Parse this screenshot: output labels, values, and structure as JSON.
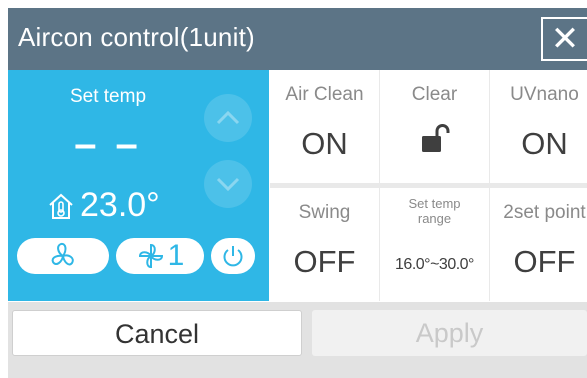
{
  "window": {
    "title": "Aircon control(1unit)",
    "close_label": "✕"
  },
  "left_panel": {
    "set_temp_label": "Set temp",
    "set_temp_value": "– –",
    "room_temp": "23.0°",
    "fan_speed_value": "1",
    "colors": {
      "accent": "#2fb7e6"
    }
  },
  "grid": [
    {
      "label": "Air Clean",
      "value": "ON"
    },
    {
      "label": "Clear",
      "icon": "unlocked-padlock-icon"
    },
    {
      "label": "UVnano",
      "value": "ON"
    },
    {
      "label": "Swing",
      "value": "OFF"
    },
    {
      "label": "Set temp range",
      "value": "16.0°~30.0°"
    },
    {
      "label": "2set point",
      "value": "OFF"
    }
  ],
  "footer": {
    "cancel_label": "Cancel",
    "apply_label": "Apply"
  }
}
